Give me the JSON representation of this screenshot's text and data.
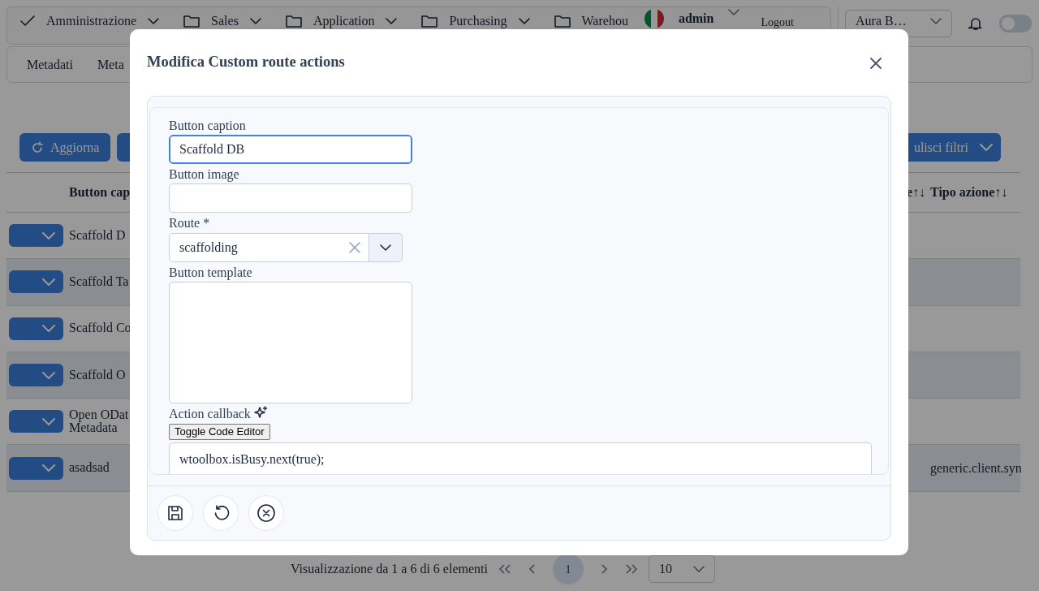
{
  "nav": {
    "items": [
      {
        "label": "Amministrazione",
        "kind": "check"
      },
      {
        "label": "Sales",
        "kind": "folder"
      },
      {
        "label": "Application",
        "kind": "folder"
      },
      {
        "label": "Purchasing",
        "kind": "folder"
      },
      {
        "label": "Warehou",
        "kind": "folder"
      }
    ],
    "user": {
      "name": "admin"
    },
    "logout": "Logout",
    "org_select": "Aura B…",
    "dark_mode": {
      "on": false
    }
  },
  "subnav": [
    "Metadati",
    "Meta"
  ],
  "toolbar": {
    "refresh": "Aggiorna",
    "clear_filters": "ulisci filtri"
  },
  "table": {
    "columns": [
      {
        "label": "Button cap"
      },
      {
        "label": "e↑↓"
      },
      {
        "label": "Tipo azione↑↓"
      }
    ],
    "rows": [
      {
        "caption": "Scaffold D"
      },
      {
        "caption": "Scaffold Ta"
      },
      {
        "caption": "Scaffold Co"
      },
      {
        "caption": "Scaffold O"
      },
      {
        "caption": "Open ODat\nMetadata"
      },
      {
        "caption": "asadsad",
        "type": "generic.client.syn"
      }
    ]
  },
  "pagination": {
    "summary": "Visualizzazione da 1 a 6 di 6 elementi",
    "pages": [
      {
        "label": "1",
        "selected": true
      }
    ],
    "page_size": "10"
  },
  "modal": {
    "title": "Modifica Custom route actions",
    "fields": [
      {
        "kind": "text",
        "label": "Button caption",
        "value": "Scaffold DB",
        "focused": true
      },
      {
        "kind": "text",
        "label": "Button image",
        "focused": false
      },
      {
        "kind": "select",
        "label": "Route *",
        "value": "scaffolding"
      },
      {
        "kind": "textarea",
        "label": "Button template"
      },
      {
        "kind": "code",
        "label": "Action callback",
        "toggle": "Toggle Code Editor",
        "code": "wtoolbox.isBusy.next(true);"
      }
    ],
    "footer_buttons": [
      {
        "kind": "save"
      },
      {
        "kind": "undo"
      },
      {
        "kind": "cancel"
      }
    ]
  }
}
